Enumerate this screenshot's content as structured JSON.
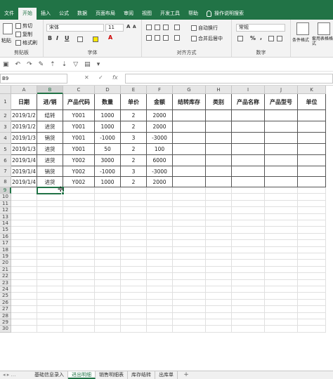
{
  "menu": {
    "tabs": [
      "文件",
      "开始",
      "插入",
      "公式",
      "数据",
      "页面布局",
      "审阅",
      "视图",
      "开发工具",
      "帮助"
    ],
    "active_index": 1,
    "tell_me": "操作说明搜索"
  },
  "ribbon": {
    "clipboard": {
      "paste": "粘贴",
      "cut": "剪切",
      "copy": "复制",
      "format_painter": "格式刷",
      "label": "剪贴板"
    },
    "font": {
      "name": "宋体",
      "size": "11",
      "bold": "B",
      "italic": "I",
      "underline": "U",
      "label": "字体"
    },
    "alignment": {
      "wrap_text": "自动换行",
      "merge_center": "合并后居中",
      "label": "对齐方式"
    },
    "number": {
      "format": "常规",
      "percent": "%",
      "comma": ",",
      "label": "数字"
    },
    "styles": {
      "conditional": "条件格式",
      "table_format": "套用表格格式"
    }
  },
  "formula_bar": {
    "name_box": "B9",
    "cancel": "✕",
    "confirm": "✓",
    "fx": "fx",
    "value": ""
  },
  "grid": {
    "columns": [
      "A",
      "B",
      "C",
      "D",
      "E",
      "F",
      "G",
      "H",
      "I",
      "J",
      "K"
    ],
    "selected_column": "B",
    "selected_row": 9,
    "row_count": 30,
    "header_row": [
      "日期",
      "进/销",
      "产品代码",
      "数量",
      "单价",
      "金额",
      "结转库存",
      "类别",
      "产品名称",
      "产品型号",
      "单位"
    ],
    "rows": [
      [
        "2019/1/2",
        "结转",
        "Y001",
        "1000",
        "2",
        "2000"
      ],
      [
        "2019/1/2",
        "进货",
        "Y001",
        "1000",
        "2",
        "2000"
      ],
      [
        "2019/1/3",
        "销货",
        "Y001",
        "-1000",
        "3",
        "-3000"
      ],
      [
        "2019/1/3",
        "进货",
        "Y001",
        "50",
        "2",
        "100"
      ],
      [
        "2019/1/4",
        "进货",
        "Y002",
        "3000",
        "2",
        "6000"
      ],
      [
        "2019/1/4",
        "销货",
        "Y002",
        "-1000",
        "3",
        "-3000"
      ],
      [
        "2019/1/4",
        "进货",
        "Y002",
        "1000",
        "2",
        "2000"
      ]
    ]
  },
  "sheets": {
    "tabs": [
      "基础信息录入",
      "进出明细",
      "销售明细表",
      "库存结转",
      "出库单"
    ],
    "active_index": 1,
    "add": "+"
  },
  "colors": {
    "accent": "#217346",
    "ribbon_bg": "#f3f3f3",
    "header_bg": "#e6e6e6"
  }
}
